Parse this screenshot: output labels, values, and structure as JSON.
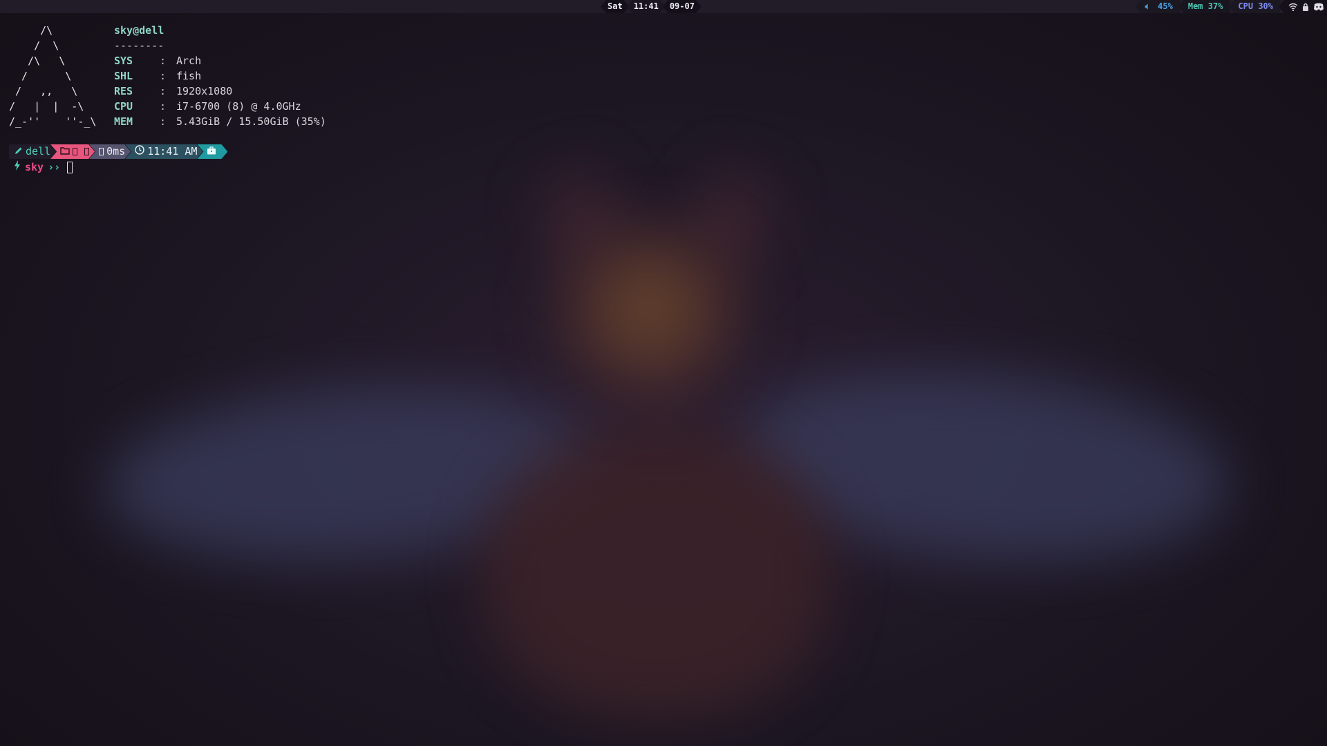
{
  "topbar": {
    "day": "Sat",
    "time": "11:41",
    "date": "09-07",
    "volume": "45%",
    "mem": "Mem 37%",
    "cpu": "CPU 30%",
    "tray_icons": [
      "wifi-icon",
      "lock-icon",
      "discord-icon"
    ],
    "colors": {
      "volume": "#4aa3e8",
      "mem": "#4fc7b3",
      "cpu": "#7e8cf0"
    }
  },
  "neofetch": {
    "art": [
      "     /\\",
      "    /  \\",
      "   /\\   \\",
      "  /      \\",
      " /   ,,   \\",
      "/   |  |  -\\",
      "/_-''    ''-_\\"
    ],
    "user_host": "sky@dell",
    "divider": "--------",
    "rows": [
      {
        "key": "SYS",
        "sep": ":",
        "value": "Arch"
      },
      {
        "key": "SHL",
        "sep": ":",
        "value": "fish"
      },
      {
        "key": "RES",
        "sep": ":",
        "value": "1920x1080"
      },
      {
        "key": "CPU",
        "sep": ":",
        "value": "i7-6700 (8) @ 4.0GHz"
      },
      {
        "key": "MEM",
        "sep": ":",
        "value": "5.43GiB / 15.50GiB (35%)"
      }
    ]
  },
  "prompt": {
    "host": "dell",
    "duration": "0ms",
    "time": "11:41 AM",
    "user": "sky",
    "arrows": "››",
    "colors": {
      "host": "#4fd0b8",
      "dir": "#e8557d",
      "duration": "#55546e",
      "time": "#2c5060",
      "git": "#1f9ba1",
      "user": "#e84d86"
    }
  }
}
